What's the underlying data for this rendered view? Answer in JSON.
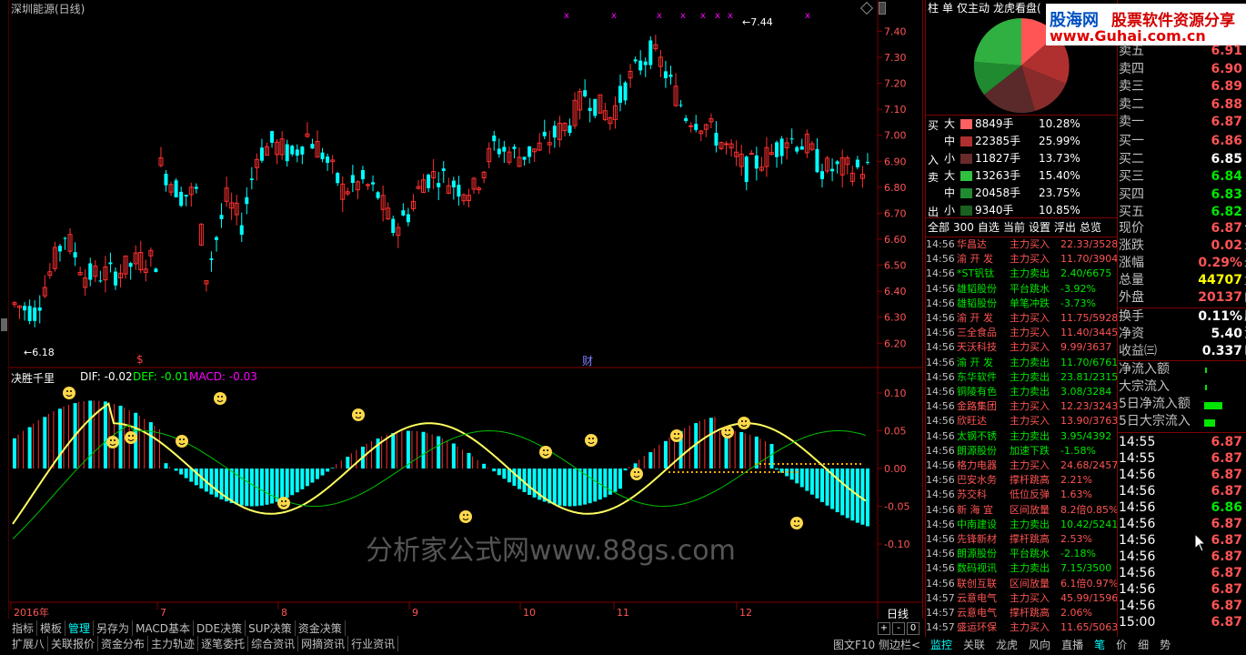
{
  "window": {
    "title": "深圳能源(日线)"
  },
  "price_axis": {
    "labels": [
      "7.40",
      "7.30",
      "7.20",
      "7.10",
      "7.00",
      "6.90",
      "6.80",
      "6.70",
      "6.60",
      "6.50",
      "6.40",
      "6.30",
      "6.20"
    ],
    "high_label": "7.44",
    "low_label": "6.18"
  },
  "indicator": {
    "name": "决胜千里",
    "dif": "DIF: -0.02",
    "dea": "DEF: -0.01",
    "macd": "MACD: -0.03",
    "axis": [
      "0.10",
      "0.05",
      "0.00",
      "-0.05",
      "-0.10"
    ]
  },
  "months": [
    "2016年",
    "7",
    "8",
    "9",
    "10",
    "11",
    "12"
  ],
  "period_label": "日线",
  "markers": {
    "s": "$",
    "cai": "财"
  },
  "bottom_tabs": [
    "指标",
    "模板",
    "管理",
    "另存为",
    "MACD基本",
    "DDE决策",
    "SUP决策",
    "资金决策"
  ],
  "bottom_tabs2": [
    "扩展八",
    "关联报价",
    "资金分布",
    "主力轨迹",
    "逐笔委托",
    "综合资讯",
    "网摘资讯",
    "行业资讯"
  ],
  "bottom_right": {
    "f10": "图文F10",
    "side": "侧边栏"
  },
  "right_top_tabs": [
    "柱",
    "单",
    "仅主动",
    "龙虎看盘("
  ],
  "flow": {
    "buy_label_1": "买",
    "buy_label_2": "入",
    "sell_label_1": "卖",
    "sell_label_2": "出",
    "rows": [
      {
        "size": "大",
        "hands": "8849手",
        "pct": "10.28%"
      },
      {
        "size": "中",
        "hands": "22385手",
        "pct": "25.99%"
      },
      {
        "size": "小",
        "hands": "11827手",
        "pct": "13.73%"
      },
      {
        "size": "大",
        "hands": "13263手",
        "pct": "15.40%"
      },
      {
        "size": "中",
        "hands": "20458手",
        "pct": "23.75%"
      },
      {
        "size": "小",
        "hands": "9340手",
        "pct": "10.85%"
      }
    ]
  },
  "news_tabs": [
    "全部",
    "300",
    "自选",
    "当前",
    "设置",
    "浮出",
    "总览"
  ],
  "news": [
    {
      "t": "14:56",
      "name": "华昌达",
      "act": "主力买入",
      "val": "22.33/3528",
      "c": "red"
    },
    {
      "t": "14:56",
      "name": "渝 开 发",
      "act": "主力买入",
      "val": "11.70/3904",
      "c": "red"
    },
    {
      "t": "14:56",
      "name": "*ST钒钛",
      "act": "主力卖出",
      "val": "2.40/6675",
      "c": "green"
    },
    {
      "t": "14:56",
      "name": "雄韬股份",
      "act": "平台跳水",
      "val": "-3.92%",
      "c": "green"
    },
    {
      "t": "14:56",
      "name": "雄韬股份",
      "act": "单笔冲跌",
      "val": "-3.73%",
      "c": "green"
    },
    {
      "t": "14:56",
      "name": "渝 开 发",
      "act": "主力买入",
      "val": "11.75/5928",
      "c": "red"
    },
    {
      "t": "14:56",
      "name": "三全食品",
      "act": "主力买入",
      "val": "11.40/3445",
      "c": "red"
    },
    {
      "t": "14:56",
      "name": "天沃科技",
      "act": "主力买入",
      "val": "9.99/3637",
      "c": "red"
    },
    {
      "t": "14:56",
      "name": "渝 开 发",
      "act": "主力卖出",
      "val": "11.70/6761",
      "c": "green"
    },
    {
      "t": "14:56",
      "name": "东华软件",
      "act": "主力卖出",
      "val": "23.81/2315",
      "c": "green"
    },
    {
      "t": "14:56",
      "name": "铜陵有色",
      "act": "主力卖出",
      "val": "3.08/3284",
      "c": "green"
    },
    {
      "t": "14:56",
      "name": "金路集团",
      "act": "主力买入",
      "val": "12.23/3243",
      "c": "red"
    },
    {
      "t": "14:56",
      "name": "欣旺达",
      "act": "主力买入",
      "val": "13.90/3763",
      "c": "red"
    },
    {
      "t": "14:56",
      "name": "太钢不锈",
      "act": "主力卖出",
      "val": "3.95/4392",
      "c": "green"
    },
    {
      "t": "14:56",
      "name": "朗源股份",
      "act": "加速下跌",
      "val": "-1.58%",
      "c": "green"
    },
    {
      "t": "14:56",
      "name": "格力电器",
      "act": "主力买入",
      "val": "24.68/2457",
      "c": "red"
    },
    {
      "t": "14:56",
      "name": "巴安水务",
      "act": "撑杆跳高",
      "val": "2.21%",
      "c": "red"
    },
    {
      "t": "14:56",
      "name": "苏交科",
      "act": "低位反弹",
      "val": "1.63%",
      "c": "red"
    },
    {
      "t": "14:56",
      "name": "新 海 宜",
      "act": "区间放量",
      "val": "8.2倍0.85%",
      "c": "red"
    },
    {
      "t": "14:56",
      "name": "中南建设",
      "act": "主力卖出",
      "val": "10.42/5241",
      "c": "green"
    },
    {
      "t": "14:56",
      "name": "先锋新材",
      "act": "撑杆跳高",
      "val": "2.53%",
      "c": "red"
    },
    {
      "t": "14:56",
      "name": "朗源股份",
      "act": "平台跳水",
      "val": "-2.18%",
      "c": "green"
    },
    {
      "t": "14:56",
      "name": "数码视讯",
      "act": "主力卖出",
      "val": "7.15/3500",
      "c": "green"
    },
    {
      "t": "14:56",
      "name": "联创互联",
      "act": "区间放量",
      "val": "6.1倍0.97%",
      "c": "red"
    },
    {
      "t": "14:57",
      "name": "云意电气",
      "act": "主力买入",
      "val": "45.99/1596",
      "c": "red"
    },
    {
      "t": "14:57",
      "name": "云意电气",
      "act": "撑杆跳高",
      "val": "2.06%",
      "c": "red"
    },
    {
      "t": "14:57",
      "name": "盛运环保",
      "act": "主力买入",
      "val": "11.65/5063",
      "c": "red"
    }
  ],
  "logo": {
    "name": "股海网",
    "text": "股票软件资源分享",
    "url": "www.Guhai.com.cn"
  },
  "watermark": "分析家公式网www.88gs.com",
  "quote": {
    "asks": [
      {
        "l": "卖五",
        "v": "6.91"
      },
      {
        "l": "卖四",
        "v": "6.90"
      },
      {
        "l": "卖三",
        "v": "6.89"
      },
      {
        "l": "卖二",
        "v": "6.88"
      },
      {
        "l": "卖一",
        "v": "6.87"
      }
    ],
    "bids": [
      {
        "l": "买一",
        "v": "6.86"
      },
      {
        "l": "买二",
        "v": "6.85"
      },
      {
        "l": "买三",
        "v": "6.84"
      },
      {
        "l": "买四",
        "v": "6.83"
      },
      {
        "l": "买五",
        "v": "6.82"
      }
    ],
    "stats": [
      {
        "l": "现价",
        "v": "6.87",
        "r": "今"
      },
      {
        "l": "涨跌",
        "v": "0.02",
        "r": "最"
      },
      {
        "l": "涨幅",
        "v": "0.29%",
        "r": "最"
      },
      {
        "l": "总量",
        "v": "44707",
        "r": "量"
      },
      {
        "l": "外盘",
        "v": "20137",
        "r": "内"
      }
    ],
    "stats2": [
      {
        "l": "换手",
        "v": "0.11%",
        "r": "股"
      },
      {
        "l": "净资",
        "v": "5.40",
        "r": "流"
      },
      {
        "l": "收益㈢",
        "v": "0.337",
        "r": "PE"
      }
    ],
    "flows": [
      "净流入额",
      "大宗流入",
      "5日净流入额",
      "5日大宗流入"
    ],
    "ticks": [
      {
        "t": "14:55",
        "v": "6.87"
      },
      {
        "t": "14:55",
        "v": "6.87"
      },
      {
        "t": "14:56",
        "v": "6.87"
      },
      {
        "t": "14:56",
        "v": "6.87"
      },
      {
        "t": "14:56",
        "v": "6.86"
      },
      {
        "t": "14:56",
        "v": "6.87"
      },
      {
        "t": "14:56",
        "v": "6.87"
      },
      {
        "t": "14:56",
        "v": "6.87"
      },
      {
        "t": "14:56",
        "v": "6.87"
      },
      {
        "t": "14:56",
        "v": "6.87"
      },
      {
        "t": "14:56",
        "v": "6.87"
      },
      {
        "t": "15:00",
        "v": "6.87"
      }
    ]
  },
  "right_bottom_tabs": [
    "监控",
    "关联",
    "龙虎",
    "风向",
    "直播",
    "笔",
    "价",
    "细",
    "势"
  ],
  "chart_data": {
    "type": "candlestick",
    "ylim": [
      6.18,
      7.44
    ],
    "high": 7.44,
    "low": 6.18
  }
}
